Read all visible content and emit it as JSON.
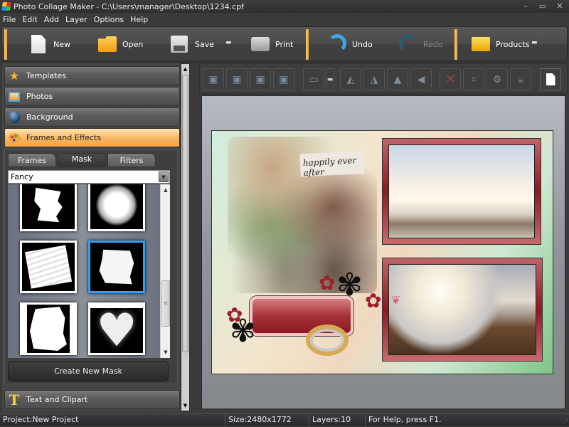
{
  "window": {
    "title": "Photo Collage Maker - C:\\Users\\manager\\Desktop\\1234.cpf",
    "controls": {
      "minimize": "–",
      "maximize": "▭",
      "close": "✕"
    }
  },
  "menu": [
    "File",
    "Edit",
    "Add",
    "Layer",
    "Options",
    "Help"
  ],
  "toolbar": {
    "new_label": "New",
    "open_label": "Open",
    "save_label": "Save",
    "print_label": "Print",
    "undo_label": "Undo",
    "redo_label": "Redo",
    "products_label": "Products",
    "dropdown_glyph": "▬",
    "accent_color": "#f5c870"
  },
  "left_panel": {
    "sections": [
      {
        "label": "Templates",
        "icon": "star-icon"
      },
      {
        "label": "Photos",
        "icon": "photos-icon"
      },
      {
        "label": "Background",
        "icon": "background-icon"
      },
      {
        "label": "Frames and Effects",
        "icon": "palette-icon",
        "active": true
      },
      {
        "label": "Text and Clipart",
        "icon": "text-icon"
      }
    ],
    "tabs": [
      "Frames",
      "Mask",
      "Filters"
    ],
    "active_tab": "Mask",
    "mask_category": "Fancy",
    "masks": [
      {
        "name": "brush-stroke-mask"
      },
      {
        "name": "swirl-circle-mask"
      },
      {
        "name": "scratched-square-mask"
      },
      {
        "name": "painted-blot-mask",
        "selected": true
      },
      {
        "name": "rough-edge-mask"
      },
      {
        "name": "heart-mask"
      }
    ],
    "create_mask_label": "Create New Mask"
  },
  "edit_toolbar": {
    "buttons": [
      "bring-to-front-icon",
      "bring-forward-icon",
      "send-backward-icon",
      "send-to-back-icon",
      "align-icon",
      "rotate-left-icon",
      "rotate-right-icon",
      "flip-horizontal-icon",
      "flip-vertical-icon",
      "delete-icon",
      "crop-icon",
      "settings-icon",
      "lock-icon",
      "page-icon"
    ]
  },
  "canvas": {
    "sign_text": "happily ever after",
    "frame_color": "#9b2a30"
  },
  "status": {
    "project": "Project:New Project",
    "size": "Size:2480x1772",
    "layers": "Layers:10",
    "help": "For Help, press F1."
  }
}
